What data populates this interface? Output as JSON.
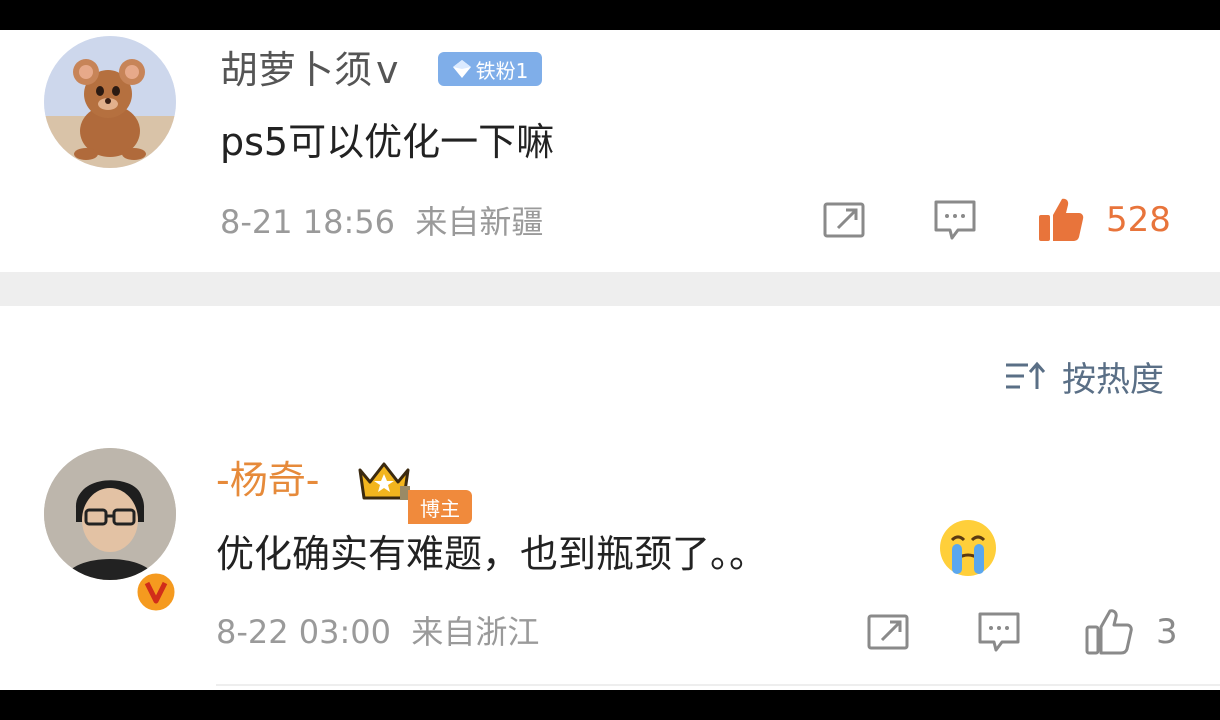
{
  "comments": [
    {
      "username": "胡萝卜须",
      "verified_suffix": "v",
      "badge": {
        "text": "铁粉1"
      },
      "text": "ps5可以优化一下嘛",
      "meta": "8-21 18:56  来自新疆",
      "likes": "528",
      "liked": true
    },
    {
      "username": "-杨奇-",
      "badge": {
        "text": "博主"
      },
      "text": "优化确实有难题，也到瓶颈了。。",
      "emoji": "crying-face",
      "meta": "8-22 03:00  来自浙江",
      "likes": "3",
      "liked": false
    }
  ],
  "sort": {
    "label": "按热度"
  },
  "icons": [
    "share-icon",
    "reply-icon",
    "thumbs-up-icon",
    "sort-icon",
    "crown-icon",
    "verified-v-icon"
  ],
  "colors": {
    "like_active": "#e8743b",
    "blogger_name": "#e68a3a",
    "sort": "#5a6f86",
    "badge_fan": "#7faee9",
    "badge_host": "#f08a3c"
  }
}
